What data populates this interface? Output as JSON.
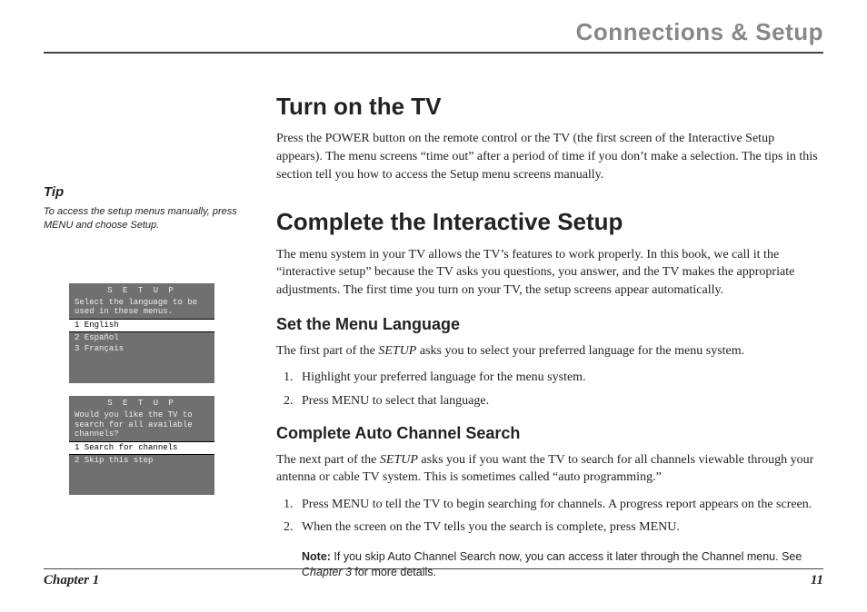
{
  "header": {
    "title": "Connections & Setup"
  },
  "sidebar": {
    "tip_heading": "Tip",
    "tip_body": "To access the setup menus manually, press MENU and choose Setup.",
    "osd1": {
      "title": "S E T U P",
      "prompt": "Select the language to be used in these menus.",
      "options": [
        "1 English",
        "2 Español",
        "3 Français"
      ],
      "selected": 0
    },
    "osd2": {
      "title": "S E T U P",
      "prompt": "Would you like the TV to search for all available channels?",
      "options": [
        "1 Search for channels",
        "2 Skip this step"
      ],
      "selected": 0
    }
  },
  "main": {
    "s1_h": "Turn on the TV",
    "s1_p": "Press the POWER button on the remote control or the TV (the first screen of the Interactive Setup appears). The menu screens “time out” after a period of time if you don’t make a selection. The tips in this section tell you how to access the Setup menu screens manually.",
    "s2_h": "Complete the Interactive Setup",
    "s2_p": "The menu system in your TV allows the TV’s features to work properly. In this book, we call it the “interactive setup” because the TV asks you questions, you answer, and the TV makes the appropriate adjustments. The first time you turn on your TV, the setup screens appear automatically.",
    "s3_h": "Set the Menu Language",
    "s3_pre": "The first part of the ",
    "s3_setup": "SETUP",
    "s3_post": " asks you to select your preferred language for the menu system.",
    "s3_steps": [
      "Highlight your preferred language for the menu system.",
      "Press MENU to select that language."
    ],
    "s4_h": "Complete Auto Channel Search",
    "s4_pre": "The next part of the ",
    "s4_setup": "SETUP",
    "s4_post": " asks you if you want the TV to search for all channels viewable through your antenna or cable TV system. This is sometimes called “auto programming.”",
    "s4_steps": [
      "Press MENU to tell the TV to begin searching for channels. A progress report appears on the screen.",
      "When the screen on the TV tells you the search is complete, press MENU."
    ],
    "note_label": "Note:",
    "note_body": " If you skip Auto Channel Search now, you can access it later through the Channel menu. See ",
    "note_chapter": "Chapter 3",
    "note_tail": " for more details."
  },
  "footer": {
    "chapter": "Chapter 1",
    "page": "11"
  }
}
